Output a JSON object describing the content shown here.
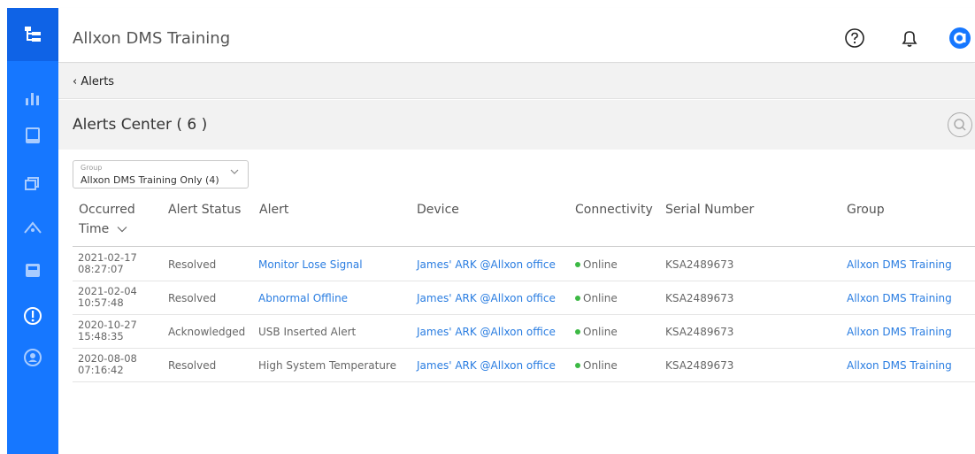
{
  "app_title": "Allxon DMS Training",
  "breadcrumb": {
    "back_label": "Alerts"
  },
  "page": {
    "title": "Alerts Center ( 6 )"
  },
  "filter": {
    "label": "Group",
    "value": "Allxon DMS Training Only (4)"
  },
  "table": {
    "headers": {
      "occurred_line1": "Occurred",
      "occurred_line2": "Time",
      "alert_status": "Alert Status",
      "alert": "Alert",
      "device": "Device",
      "connectivity": "Connectivity",
      "serial": "Serial Number",
      "group": "Group"
    },
    "rows": [
      {
        "date": "2021-02-17",
        "time": "08:27:07",
        "status": "Resolved",
        "alert": "Monitor Lose Signal",
        "device": "James' ARK @Allxon office",
        "connectivity": "Online",
        "serial": "KSA2489673",
        "group": "Allxon DMS Training"
      },
      {
        "date": "2021-02-04",
        "time": "10:57:48",
        "status": "Resolved",
        "alert": "Abnormal Offline",
        "device": "James' ARK @Allxon office",
        "connectivity": "Online",
        "serial": "KSA2489673",
        "group": "Allxon DMS Training"
      },
      {
        "date": "2020-10-27",
        "time": "15:48:35",
        "status": "Acknowledged",
        "alert": "USB Inserted Alert",
        "device": "James' ARK @Allxon office",
        "connectivity": "Online",
        "serial": "KSA2489673",
        "group": "Allxon DMS Training"
      },
      {
        "date": "2020-08-08",
        "time": "07:16:42",
        "status": "Resolved",
        "alert": "High System Temperature",
        "device": "James' ARK @Allxon office",
        "connectivity": "Online",
        "serial": "KSA2489673",
        "group": "Allxon DMS Training"
      }
    ]
  },
  "colors": {
    "sidebar": "#1677ff",
    "link": "#2a7de1",
    "online": "#3cb944"
  }
}
